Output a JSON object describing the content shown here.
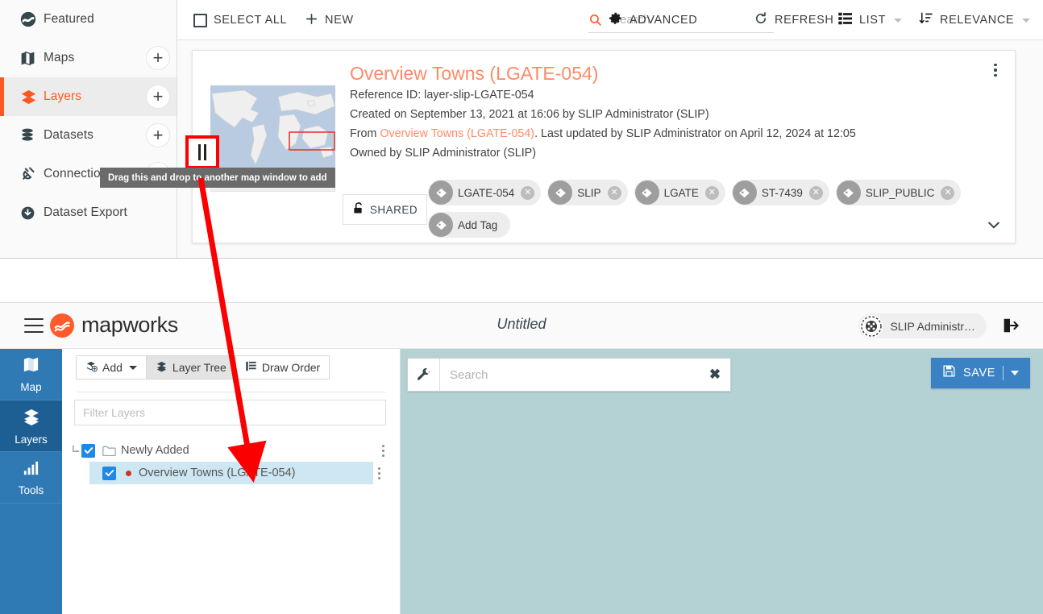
{
  "catalogue": {
    "sidebar": {
      "items": [
        {
          "label": "Featured",
          "icon": "featured-icon",
          "has_add": false,
          "active": false
        },
        {
          "label": "Maps",
          "icon": "map-icon",
          "has_add": true,
          "active": false
        },
        {
          "label": "Layers",
          "icon": "layers-icon",
          "has_add": true,
          "active": true
        },
        {
          "label": "Datasets",
          "icon": "database-icon",
          "has_add": true,
          "active": false
        },
        {
          "label": "Connections",
          "icon": "plug-icon",
          "has_add": true,
          "active": false
        },
        {
          "label": "Dataset Export",
          "icon": "download-cloud-icon",
          "has_add": false,
          "active": false
        }
      ],
      "add_label": "+"
    },
    "toolbar": {
      "select_all": "SELECT ALL",
      "new": "NEW",
      "advanced": "ADVANCED",
      "refresh": "REFRESH",
      "view_mode": "LIST",
      "sort_mode": "RELEVANCE"
    },
    "search": {
      "value": "",
      "placeholder": "Search"
    },
    "card": {
      "title": "Overview Towns (LGATE-054)",
      "reference_id": "Reference ID: layer-slip-LGATE-054",
      "created": "Created on September 13, 2021 at 16:06 by SLIP Administrator (SLIP)",
      "from_prefix": "From ",
      "from_link": "Overview Towns (LGATE-054)",
      "from_suffix": ". Last updated by SLIP Administrator on April 12, 2024 at 12:05",
      "owned": "Owned by SLIP Administrator (SLIP)",
      "shared_label": "SHARED",
      "tags": [
        {
          "label": "LGATE-054",
          "removable": true
        },
        {
          "label": "SLIP",
          "removable": true
        },
        {
          "label": "LGATE",
          "removable": true
        },
        {
          "label": "ST-7439",
          "removable": true
        },
        {
          "label": "SLIP_PUBLIC",
          "removable": true
        }
      ],
      "add_tag_label": "Add Tag",
      "tag_remove_glyph": "✕"
    },
    "tooltip": "Drag this and drop to another map window to add"
  },
  "mapworks": {
    "brand": "mapworks",
    "title": "Untitled",
    "user": "SLIP Administr…",
    "tabs": [
      {
        "label": "Map",
        "icon": "map-icon",
        "active": false
      },
      {
        "label": "Layers",
        "icon": "layers-icon",
        "active": true
      },
      {
        "label": "Tools",
        "icon": "chart-bars-icon",
        "active": false
      }
    ],
    "panel": {
      "buttons": [
        {
          "label": "Add",
          "icon": "add-layer-icon",
          "has_caret": true,
          "active": false
        },
        {
          "label": "Layer Tree",
          "icon": "layers-icon",
          "has_caret": false,
          "active": true
        },
        {
          "label": "Draw Order",
          "icon": "list-lines-icon",
          "has_caret": false,
          "active": false
        }
      ],
      "filter": {
        "value": "",
        "placeholder": "Filter Layers"
      },
      "tree": [
        {
          "label": "Newly Added",
          "type": "folder",
          "checked": true,
          "selected": false,
          "depth": 0
        },
        {
          "label": "Overview Towns (LGATE-054)",
          "type": "layer",
          "checked": true,
          "selected": true,
          "depth": 1
        }
      ]
    },
    "map": {
      "search": {
        "value": "",
        "placeholder": "Search"
      },
      "clear_glyph": "✖",
      "save_label": "SAVE"
    }
  },
  "colors": {
    "accent_orange": "#ff5722",
    "title_orange": "#ff8a65",
    "tab_blue": "#2f79b5",
    "tab_blue_active": "#1d5e93",
    "save_blue": "#3a82c4",
    "map_canvas": "#b4d1d4",
    "arrow_red": "#fa0000",
    "tree_selected": "#cde7f3"
  }
}
